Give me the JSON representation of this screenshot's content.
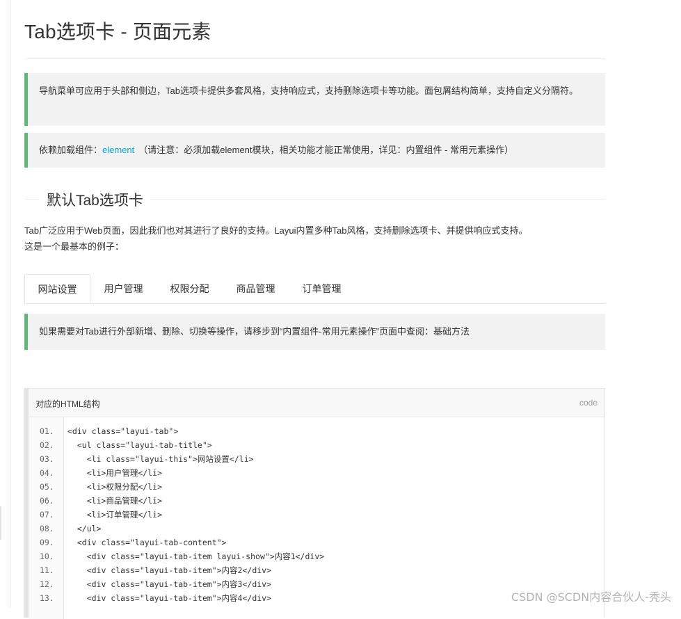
{
  "page": {
    "title": "Tab选项卡 - 页面元素"
  },
  "intro": {
    "text": "导航菜单可应用于头部和侧边，Tab选项卡提供多套风格，支持响应式，支持删除选项卡等功能。面包屑结构简单，支持自定义分隔符。"
  },
  "dependency": {
    "prefix": "依赖加载组件：",
    "link": "element",
    "note": "（请注意：必须加载element模块，相关功能才能正常使用，详见：内置组件 - 常用元素操作）"
  },
  "section": {
    "title": "默认Tab选项卡",
    "desc_line1": "Tab广泛应用于Web页面，因此我们也对其进行了良好的支持。Layui内置多种Tab风格，支持删除选项卡、并提供响应式支持。",
    "desc_line2": "这是一个最基本的例子："
  },
  "tabs": [
    {
      "label": "网站设置",
      "active": true
    },
    {
      "label": "用户管理",
      "active": false
    },
    {
      "label": "权限分配",
      "active": false
    },
    {
      "label": "商品管理",
      "active": false
    },
    {
      "label": "订单管理",
      "active": false
    }
  ],
  "tip": {
    "text": "如果需要对Tab进行外部新增、删除、切换等操作，请移步到“内置组件-常用元素操作”页面中查阅：基础方法"
  },
  "code": {
    "header": "对应的HTML结构",
    "tag": "code",
    "lines": [
      {
        "num": "01.",
        "text": "<div class=\"layui-tab\">"
      },
      {
        "num": "02.",
        "text": "  <ul class=\"layui-tab-title\">"
      },
      {
        "num": "03.",
        "text": "    <li class=\"layui-this\">网站设置</li>"
      },
      {
        "num": "04.",
        "text": "    <li>用户管理</li>"
      },
      {
        "num": "05.",
        "text": "    <li>权限分配</li>"
      },
      {
        "num": "06.",
        "text": "    <li>商品管理</li>"
      },
      {
        "num": "07.",
        "text": "    <li>订单管理</li>"
      },
      {
        "num": "08.",
        "text": "  </ul>"
      },
      {
        "num": "09.",
        "text": "  <div class=\"layui-tab-content\">"
      },
      {
        "num": "10.",
        "text": "    <div class=\"layui-tab-item layui-show\">内容1</div>"
      },
      {
        "num": "11.",
        "text": "    <div class=\"layui-tab-item\">内容2</div>"
      },
      {
        "num": "12.",
        "text": "    <div class=\"layui-tab-item\">内容3</div>"
      },
      {
        "num": "13.",
        "text": "    <div class=\"layui-tab-item\">内容4</div>"
      }
    ]
  },
  "watermark": "CSDN @SCDN内容合伙人-秃头",
  "colors": {
    "accent": "#5fb878",
    "link": "#01aaed",
    "quote_bg": "#f2f2f2"
  }
}
